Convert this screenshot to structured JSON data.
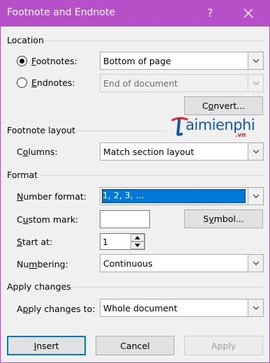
{
  "dialog": {
    "title": "Footnote and Endnote",
    "help_glyph": "?"
  },
  "location": {
    "heading": "Location",
    "footnotes": {
      "label_accel": "F",
      "label_rest": "ootnotes:",
      "checked": true,
      "value": "Bottom of page"
    },
    "endnotes": {
      "label_accel": "E",
      "label_rest": "ndnotes:",
      "checked": false,
      "value": "End of document"
    },
    "convert": {
      "label_pre": "C",
      "label_accel": "o",
      "label_post": "nvert..."
    }
  },
  "layout": {
    "heading": "Footnote layout",
    "columns": {
      "label_pre": "C",
      "label_accel": "o",
      "label_post": "lumns:",
      "value": "Match section layout"
    }
  },
  "watermark": {
    "text": "aimienphi",
    "suffix": ".vn"
  },
  "format": {
    "heading": "Format",
    "number_format": {
      "label_accel": "N",
      "label_rest": "umber format:",
      "value": "1, 2, 3, ..."
    },
    "custom_mark": {
      "label_pre": "C",
      "label_accel": "u",
      "label_post": "stom mark:",
      "value": ""
    },
    "symbol": {
      "label_pre": "S",
      "label_accel": "y",
      "label_post": "mbol..."
    },
    "start_at": {
      "label_accel": "S",
      "label_rest": "tart at:",
      "value": "1"
    },
    "numbering": {
      "label_pre": "Nu",
      "label_accel": "m",
      "label_post": "bering:",
      "value": "Continuous"
    }
  },
  "apply": {
    "heading": "Apply changes",
    "apply_to": {
      "label_pre": "A",
      "label_accel": "p",
      "label_post": "ply changes to:",
      "value": "Whole document"
    }
  },
  "buttons": {
    "insert": {
      "label_accel": "I",
      "label_rest": "nsert"
    },
    "cancel": "Cancel",
    "apply": "Apply"
  },
  "colors": {
    "titlebar": "#b64fc8",
    "client": "#f0f0f0",
    "focus": "#0078d7"
  }
}
